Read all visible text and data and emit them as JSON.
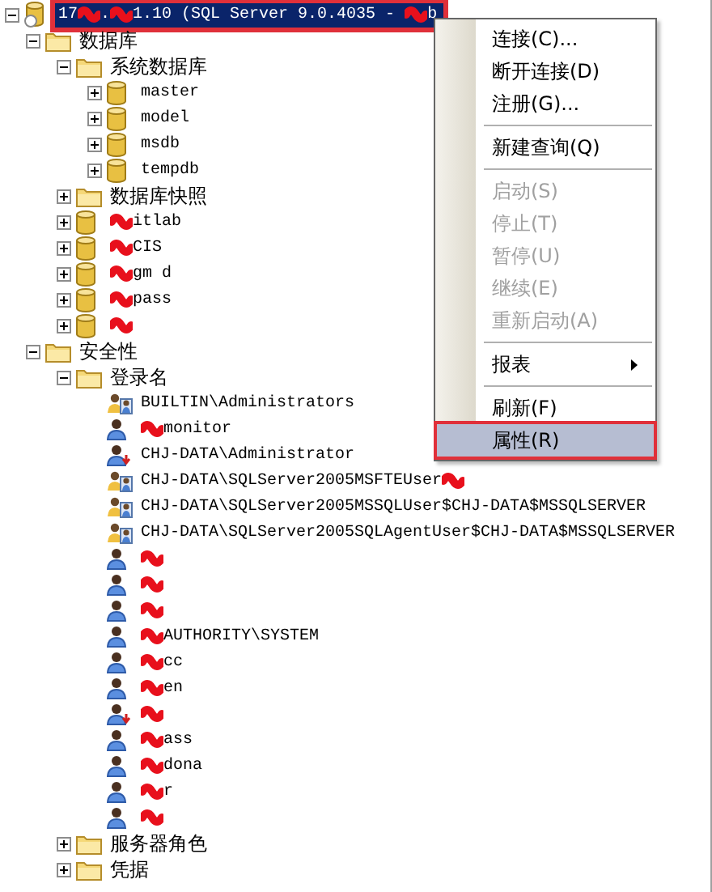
{
  "tree": {
    "kind": "server",
    "selected": true,
    "expanded": true,
    "parts": [
      {
        "kind": "text",
        "text": "17"
      },
      {
        "kind": "redacted"
      },
      {
        "kind": "text",
        "text": "."
      },
      {
        "kind": "redacted"
      },
      {
        "kind": "text",
        "text": "1.10 (SQL Server 9.0.4035 - "
      },
      {
        "kind": "redacted"
      },
      {
        "kind": "text",
        "text": "b"
      }
    ],
    "children": [
      {
        "kind": "folder",
        "label": "数据库",
        "expanded": true,
        "children": [
          {
            "kind": "folder",
            "label": "系统数据库",
            "expanded": true,
            "children": [
              {
                "kind": "database",
                "label": "master",
                "expanded": false
              },
              {
                "kind": "database",
                "label": "model",
                "expanded": false
              },
              {
                "kind": "database",
                "label": "msdb",
                "expanded": false
              },
              {
                "kind": "database",
                "label": "tempdb",
                "expanded": false
              }
            ]
          },
          {
            "kind": "folder",
            "label": "数据库快照",
            "expanded": false
          },
          {
            "kind": "database",
            "expanded": false,
            "parts": [
              {
                "kind": "redacted"
              },
              {
                "kind": "text",
                "text": "itlab"
              }
            ]
          },
          {
            "kind": "database",
            "expanded": false,
            "parts": [
              {
                "kind": "redacted"
              },
              {
                "kind": "text",
                "text": "CIS"
              }
            ]
          },
          {
            "kind": "database",
            "expanded": false,
            "parts": [
              {
                "kind": "redacted"
              },
              {
                "kind": "text",
                "text": "gm d"
              }
            ]
          },
          {
            "kind": "database",
            "expanded": false,
            "parts": [
              {
                "kind": "redacted"
              },
              {
                "kind": "text",
                "text": "pass"
              }
            ]
          },
          {
            "kind": "database",
            "expanded": false,
            "parts": [
              {
                "kind": "redacted"
              }
            ]
          }
        ]
      },
      {
        "kind": "folder",
        "label": "安全性",
        "expanded": true,
        "children": [
          {
            "kind": "folder",
            "label": "登录名",
            "expanded": true,
            "children": [
              {
                "kind": "group",
                "label": "BUILTIN\\Administrators"
              },
              {
                "kind": "user",
                "parts": [
                  {
                    "kind": "redacted"
                  },
                  {
                    "kind": "text",
                    "text": "monitor"
                  }
                ]
              },
              {
                "kind": "disabled-user",
                "label": "CHJ-DATA\\Administrator"
              },
              {
                "kind": "group",
                "parts": [
                  {
                    "kind": "text",
                    "text": "CHJ-DATA\\SQLServer2005MSFTEUser"
                  },
                  {
                    "kind": "redacted"
                  }
                ]
              },
              {
                "kind": "group",
                "label": "CHJ-DATA\\SQLServer2005MSSQLUser$CHJ-DATA$MSSQLSERVER"
              },
              {
                "kind": "group",
                "label": "CHJ-DATA\\SQLServer2005SQLAgentUser$CHJ-DATA$MSSQLSERVER"
              },
              {
                "kind": "user",
                "parts": [
                  {
                    "kind": "redacted"
                  }
                ]
              },
              {
                "kind": "user",
                "parts": [
                  {
                    "kind": "redacted"
                  }
                ]
              },
              {
                "kind": "user",
                "parts": [
                  {
                    "kind": "redacted"
                  }
                ]
              },
              {
                "kind": "user",
                "parts": [
                  {
                    "kind": "redacted"
                  },
                  {
                    "kind": "text",
                    "text": "AUTHORITY\\SYSTEM"
                  }
                ]
              },
              {
                "kind": "user",
                "parts": [
                  {
                    "kind": "redacted"
                  },
                  {
                    "kind": "text",
                    "text": "cc"
                  }
                ]
              },
              {
                "kind": "user",
                "parts": [
                  {
                    "kind": "redacted"
                  },
                  {
                    "kind": "text",
                    "text": "en"
                  }
                ]
              },
              {
                "kind": "disabled-user",
                "parts": [
                  {
                    "kind": "redacted"
                  }
                ]
              },
              {
                "kind": "user",
                "parts": [
                  {
                    "kind": "redacted"
                  },
                  {
                    "kind": "text",
                    "text": "ass"
                  }
                ]
              },
              {
                "kind": "user",
                "parts": [
                  {
                    "kind": "redacted"
                  },
                  {
                    "kind": "text",
                    "text": "dona"
                  }
                ]
              },
              {
                "kind": "user",
                "parts": [
                  {
                    "kind": "redacted"
                  },
                  {
                    "kind": "text",
                    "text": "r"
                  }
                ]
              },
              {
                "kind": "user",
                "parts": [
                  {
                    "kind": "redacted"
                  }
                ]
              }
            ]
          },
          {
            "kind": "folder",
            "label": "服务器角色",
            "expanded": false
          },
          {
            "kind": "folder",
            "label": "凭据",
            "expanded": false
          }
        ]
      }
    ]
  },
  "context_menu": {
    "items": [
      {
        "kind": "item",
        "label": "连接(C)...",
        "disabled": false,
        "selected": false
      },
      {
        "kind": "item",
        "label": "断开连接(D)",
        "disabled": false,
        "selected": false
      },
      {
        "kind": "item",
        "label": "注册(G)...",
        "disabled": false,
        "selected": false
      },
      {
        "kind": "separator"
      },
      {
        "kind": "item",
        "label": "新建查询(Q)",
        "disabled": false,
        "selected": false
      },
      {
        "kind": "separator"
      },
      {
        "kind": "item",
        "label": "启动(S)",
        "disabled": true,
        "selected": false
      },
      {
        "kind": "item",
        "label": "停止(T)",
        "disabled": true,
        "selected": false
      },
      {
        "kind": "item",
        "label": "暂停(U)",
        "disabled": true,
        "selected": false
      },
      {
        "kind": "item",
        "label": "继续(E)",
        "disabled": true,
        "selected": false
      },
      {
        "kind": "item",
        "label": "重新启动(A)",
        "disabled": true,
        "selected": false
      },
      {
        "kind": "separator"
      },
      {
        "kind": "submenu",
        "label": "报表",
        "disabled": false,
        "selected": false
      },
      {
        "kind": "separator"
      },
      {
        "kind": "item",
        "label": "刷新(F)",
        "disabled": false,
        "selected": false
      },
      {
        "kind": "item",
        "label": "属性(R)",
        "disabled": false,
        "selected": true
      }
    ]
  }
}
